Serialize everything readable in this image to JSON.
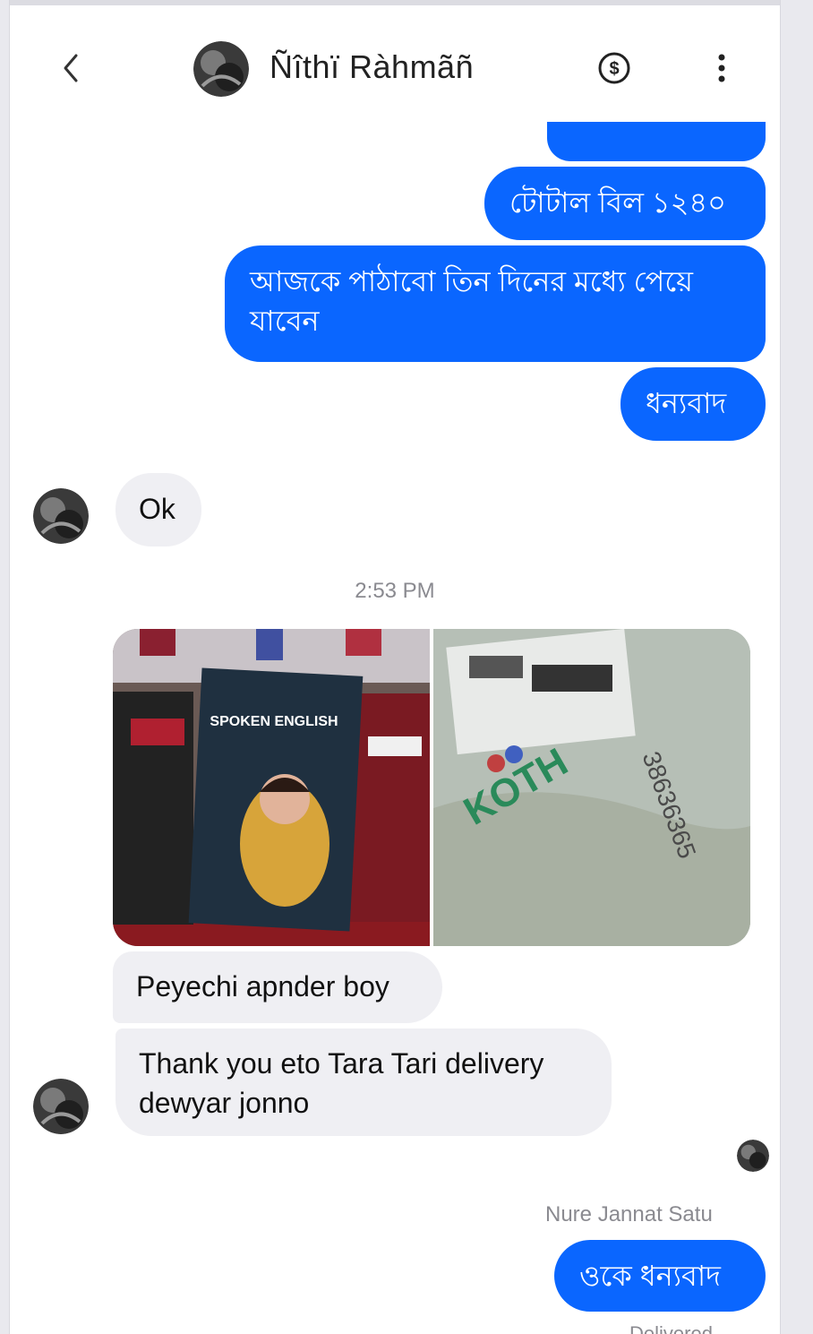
{
  "header": {
    "contact_name": "Ñîthï Ràhmãñ",
    "back_icon": "chevron-left-icon",
    "money_icon": "dollar-circle-icon",
    "more_icon": "more-vertical-icon"
  },
  "messages": {
    "out_partial": "",
    "out_1": "টোটাল বিল ১২৪০",
    "out_2": "আজকে পাঠাবো তিন দিনের মধ্যে পেয়ে যাবেন",
    "out_3": "ধন্যবাদ",
    "in_1": "Ok",
    "timestamp": "2:53 PM",
    "photo_1_text": "SPOKEN ENGLISH",
    "in_2": "Peyechi apnder boy",
    "in_3": "Thank you eto Tara Tari delivery dewyar jonno",
    "reply_sender": "Nure Jannat Satu",
    "out_4": "ওকে ধন্যবাদ",
    "status_partial": "Delivered"
  },
  "colors": {
    "outgoing": "#0a66ff",
    "incoming": "#efeff3"
  }
}
